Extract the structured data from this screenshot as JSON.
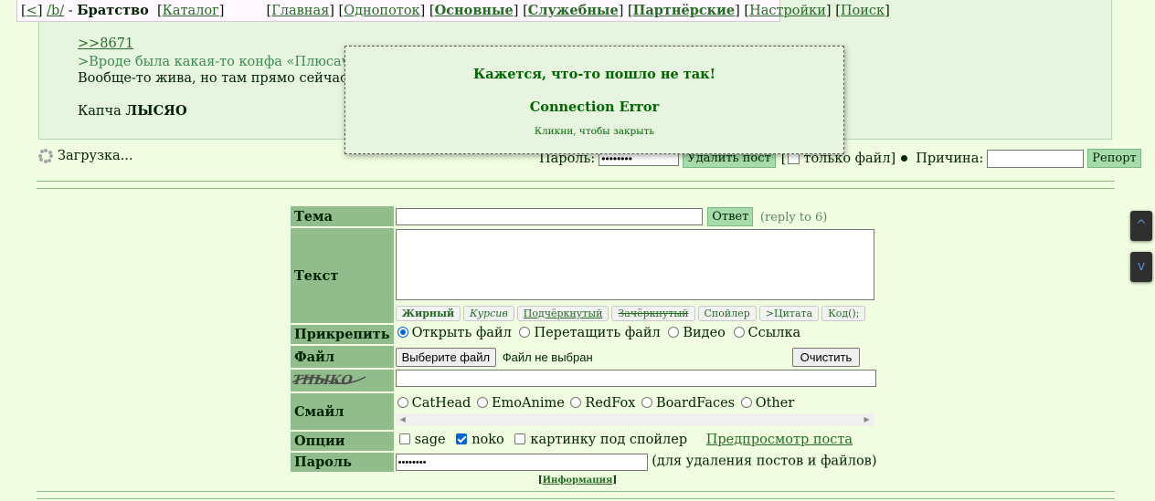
{
  "nav": {
    "back": "<",
    "board_link": "/b/",
    "dash": "-",
    "board_name": "Братство",
    "catalog": "Каталог",
    "links": [
      "Главная",
      "Однопоток",
      "Основные",
      "Служебные",
      "Партнёрские",
      "Настройки",
      "Поиск"
    ]
  },
  "post": {
    "reflink": ">>8671",
    "quote": ">Вроде была какая-то конфа «Плюсач», тог",
    "line2": "Вообще-то жива, но там прямо сейчас блок",
    "line3_prefix": "Капча",
    "line3_bold": "ЛЫСЯО"
  },
  "popup": {
    "title": "Кажется, что-то пошло не так!",
    "error": "Connection Error",
    "hint": "Кликни, чтобы закрыть"
  },
  "loading": "Загрузка...",
  "delete_row": {
    "password_label": "Пароль:",
    "password_value": "••••••••",
    "delete_button": "Удалить пост",
    "file_only_open": "[",
    "file_only_label": "только файл]",
    "reason_label": "Причина:",
    "report_button": "Репорт"
  },
  "form": {
    "subject_label": "Тема",
    "reply_button": "Ответ",
    "reply_to": "(reply to 6)",
    "text_label": "Текст",
    "format_buttons": [
      "Жирный",
      "Курсив",
      "Подчёркнутый",
      "Зачёркнутый",
      "Спойлер",
      ">Цитата",
      "Код();"
    ],
    "attach_label": "Прикрепить",
    "attach_options": [
      "Открыть файл",
      "Перетащить файл",
      "Видео",
      "Ссылка"
    ],
    "file_label": "Файл",
    "choose_file": "Выберите файл",
    "no_file": "Файл не выбран",
    "clear": "Очистить",
    "captcha_text": "ТНЫКО",
    "smile_label": "Смайл",
    "smiles": [
      "CatHead",
      "EmoAnime",
      "RedFox",
      "BoardFaces",
      "Other"
    ],
    "options_label": "Опции",
    "options": [
      "sage",
      "noko",
      "картинку под спойлер"
    ],
    "preview": "Предпросмотр поста",
    "password_label": "Пароль",
    "password_value": "••••••••",
    "password_hint": "(для удаления постов и файлов)",
    "info": "Информация"
  },
  "side": {
    "up": "^",
    "down": "v"
  }
}
